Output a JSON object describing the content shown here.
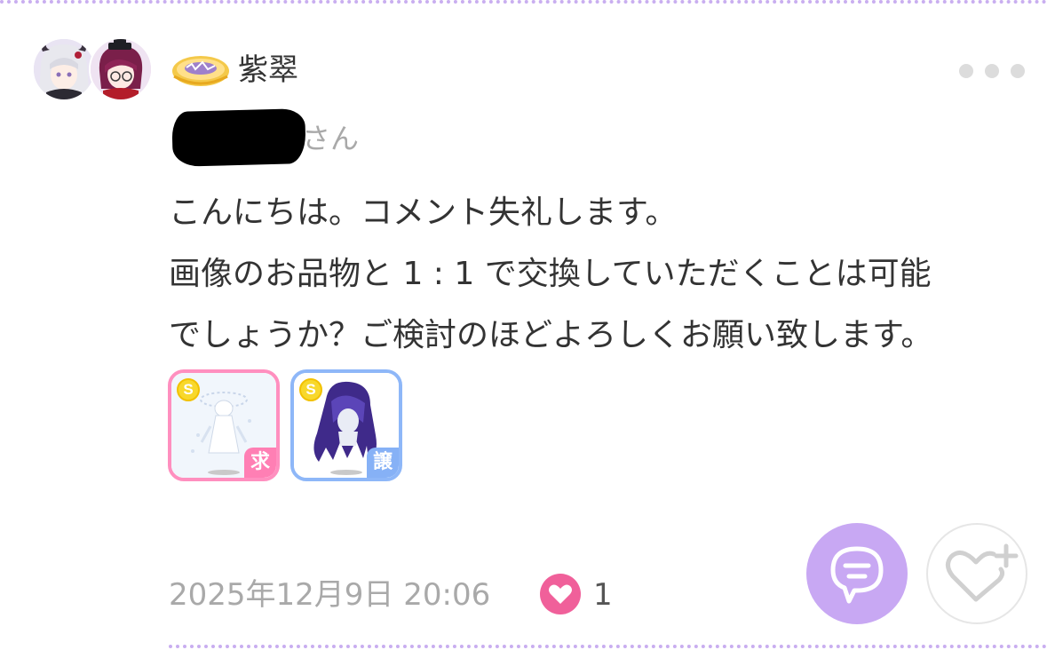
{
  "comment": {
    "username": "紫翠",
    "badge_icon": "gold-ornament-badge-icon",
    "mention_suffix": "さん",
    "message_lines": [
      "こんにちは。コメント失礼します。",
      "画像のお品物と 1 : 1 で交換していただくことは可能",
      "でしょうか？ご検討のほどよろしくお願い致します。"
    ],
    "items": [
      {
        "coin_label": "S",
        "tag": "求",
        "icon": "white-dress-item-icon",
        "tag_color": "#ff7fb4"
      },
      {
        "coin_label": "S",
        "tag": "譲",
        "icon": "purple-hair-item-icon",
        "tag_color": "#86b1f6"
      }
    ],
    "timestamp": "2025年12月9日 20:06",
    "like_count": "1"
  },
  "actions": {
    "comment_icon": "chat-bubble-icon",
    "heart_icon": "heart-plus-icon",
    "more_icon": "more-dots-icon"
  },
  "colors": {
    "accent_purple": "#c8a8f3",
    "want_pink": "#ff8fbf",
    "give_blue": "#8eb7f8",
    "like_pink": "#f0609a"
  }
}
